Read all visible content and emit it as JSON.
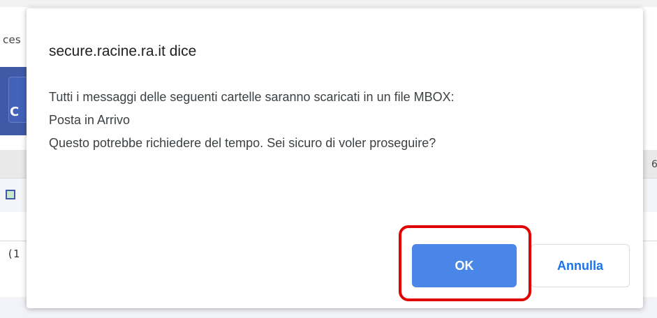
{
  "background": {
    "left_text": "ces",
    "button_label": "C",
    "table_text": "(1",
    "right_char": "6"
  },
  "dialog": {
    "title": "secure.racine.ra.it dice",
    "message_lines": [
      "Tutti i messaggi delle seguenti cartelle saranno scaricati in un file MBOX:",
      "Posta in Arrivo",
      "Questo potrebbe richiedere del tempo. Sei sicuro di voler proseguire?"
    ],
    "ok_label": "OK",
    "cancel_label": "Annulla"
  },
  "colors": {
    "ok_button": "#4a86e8",
    "cancel_text": "#1a73e8",
    "highlight": "#e00000",
    "bg_blue": "#3f5aa6"
  },
  "icons": {
    "bg_icon": "checkbox-icon"
  }
}
